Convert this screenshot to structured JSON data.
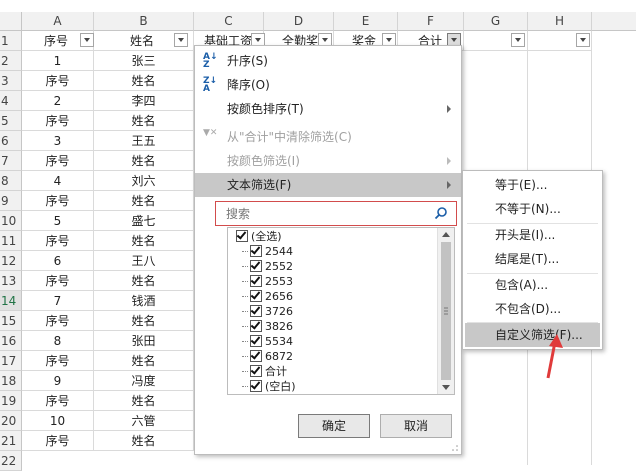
{
  "columns": [
    "A",
    "B",
    "C",
    "D",
    "E",
    "F",
    "G",
    "H"
  ],
  "header_row": [
    "序号",
    "姓名",
    "基础工资",
    "全勤奖",
    "奖金",
    "合计",
    "",
    ""
  ],
  "rows": [
    [
      "1",
      "张三"
    ],
    [
      "序号",
      "姓名"
    ],
    [
      "2",
      "李四"
    ],
    [
      "序号",
      "姓名"
    ],
    [
      "3",
      "王五"
    ],
    [
      "序号",
      "姓名"
    ],
    [
      "4",
      "刘六"
    ],
    [
      "序号",
      "姓名"
    ],
    [
      "5",
      "盛七"
    ],
    [
      "序号",
      "姓名"
    ],
    [
      "6",
      "王八"
    ],
    [
      "序号",
      "姓名"
    ],
    [
      "7",
      "钱酒"
    ],
    [
      "序号",
      "姓名"
    ],
    [
      "8",
      "张田"
    ],
    [
      "序号",
      "姓名"
    ],
    [
      "9",
      "冯度"
    ],
    [
      "序号",
      "姓名"
    ],
    [
      "10",
      "六管"
    ],
    [
      "序号",
      "姓名"
    ]
  ],
  "row_numbers": [
    "1",
    "2",
    "3",
    "4",
    "5",
    "6",
    "7",
    "8",
    "9",
    "10",
    "11",
    "12",
    "13",
    "14",
    "15",
    "16",
    "17",
    "18",
    "19",
    "20",
    "21",
    "22"
  ],
  "menu": {
    "sort_asc": "升序(S)",
    "sort_desc": "降序(O)",
    "sort_by_color": "按颜色排序(T)",
    "clear_filter": "从\"合计\"中清除筛选(C)",
    "filter_by_color": "按颜色筛选(I)",
    "text_filter": "文本筛选(F)",
    "search_placeholder": "搜索",
    "list_items": [
      "(全选)",
      "2544",
      "2552",
      "2553",
      "2656",
      "3726",
      "3826",
      "5534",
      "6872",
      "合计",
      "(空白)"
    ],
    "ok": "确定",
    "cancel": "取消"
  },
  "submenu": {
    "items": [
      "等于(E)...",
      "不等于(N)...",
      "开头是(I)...",
      "结尾是(T)...",
      "包含(A)...",
      "不包含(D)...",
      "自定义筛选(F)..."
    ]
  },
  "colors": {
    "accent": "#217346",
    "highlight": "#c8c8c8",
    "arrow": "#e03a3a",
    "search_border": "#d24c4c"
  }
}
